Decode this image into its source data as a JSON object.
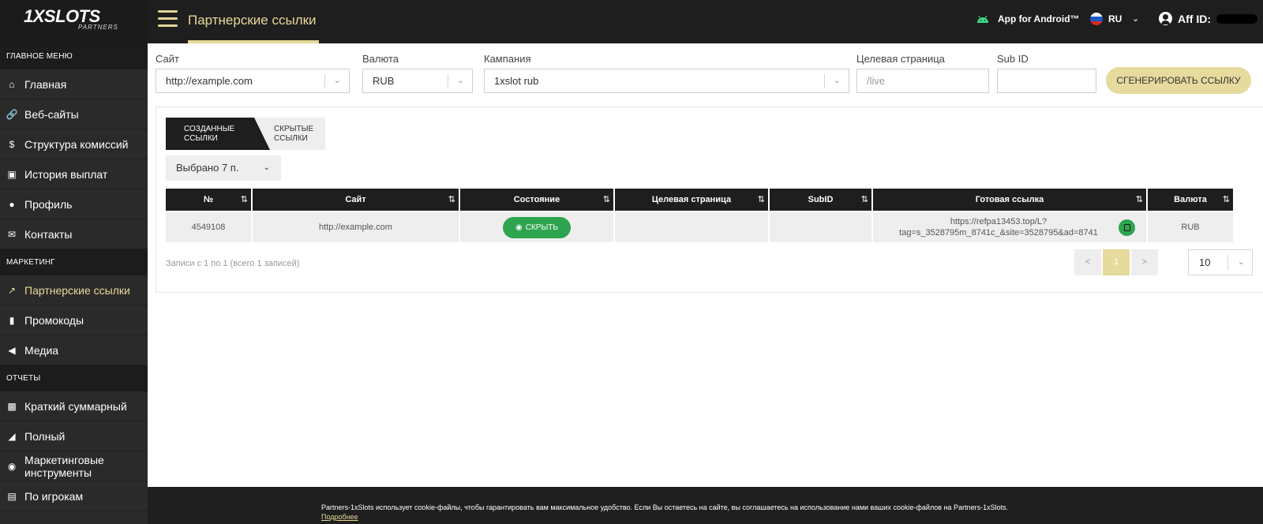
{
  "brand": {
    "logo_main": "1XSLOTS",
    "logo_sub": "PARTNERS"
  },
  "header": {
    "title": "Партнерские ссылки",
    "android_label": "App for Android™",
    "language": "RU",
    "aff_label": "Aff ID:"
  },
  "sidebar": {
    "sections": [
      {
        "title": "ГЛАВНОЕ МЕНЮ",
        "items": [
          {
            "label": "Главная",
            "icon": "home-icon"
          },
          {
            "label": "Веб-сайты",
            "icon": "link-icon"
          },
          {
            "label": "Структура комиссий",
            "icon": "dollar-icon"
          },
          {
            "label": "История выплат",
            "icon": "money-icon"
          },
          {
            "label": "Профиль",
            "icon": "user-icon"
          },
          {
            "label": "Контакты",
            "icon": "envelope-icon"
          }
        ]
      },
      {
        "title": "МАРКЕТИНГ",
        "items": [
          {
            "label": "Партнерские ссылки",
            "icon": "external-link-icon",
            "active": true
          },
          {
            "label": "Промокоды",
            "icon": "barcode-icon"
          },
          {
            "label": "Медиа",
            "icon": "bullhorn-icon"
          }
        ]
      },
      {
        "title": "ОТЧЕТЫ",
        "items": [
          {
            "label": "Краткий суммарный",
            "icon": "bar-chart-icon"
          },
          {
            "label": "Полный",
            "icon": "area-chart-icon"
          },
          {
            "label": "Маркетинговые инструменты",
            "icon": "palette-icon"
          },
          {
            "label": "По игрокам",
            "icon": "id-card-icon"
          }
        ]
      }
    ]
  },
  "filters": {
    "site_label": "Сайт",
    "site_value": "http://example.com",
    "currency_label": "Валюта",
    "currency_value": "RUB",
    "campaign_label": "Кампания",
    "campaign_value": "1xslot rub",
    "landing_label": "Целевая страница",
    "landing_placeholder": "/live",
    "subid_label": "Sub ID",
    "subid_value": "",
    "generate_button": "СГЕНЕРИРОВАТЬ ССЫЛКУ"
  },
  "tabs": {
    "created_line1": "СОЗДАННЫЕ",
    "created_line2": "ССЫЛКИ",
    "hidden_line1": "СКРЫТЫЕ",
    "hidden_line2": "ССЫЛКИ"
  },
  "columns_select": "Выбрано 7 п.",
  "table": {
    "headers": [
      "№",
      "Сайт",
      "Состояние",
      "Целевая страница",
      "SubID",
      "Готовая ссылка",
      "Валюта"
    ],
    "rows": [
      {
        "id": "4549108",
        "site": "http://example.com",
        "state_button": "СКРЫТЬ",
        "landing": "",
        "subid": "",
        "link_line1": "https://refpa13453.top/L?",
        "link_line2": "tag=s_3528795m_8741c_&site=3528795&ad=8741",
        "currency": "RUB"
      }
    ]
  },
  "pagination": {
    "records_text": "Записи с 1 по 1 (всего 1 записей)",
    "prev": "<",
    "current": "1",
    "next": ">",
    "per_page": "10"
  },
  "cookie": {
    "text": "Partners-1xSlots использует cookie-файлы, чтобы гарантировать вам максимальное удобство. Если Вы остаетесь на сайте, вы соглашаетесь на использование нами ваших cookie-файлов на Partners-1xSlots.",
    "link": "Подробнее"
  },
  "colors": {
    "accent": "#e8d99a",
    "button_gold": "#e6da9d",
    "success": "#2ea44f",
    "header_bg": "#1e1e1e",
    "sidebar_bg": "#2a2a2a"
  }
}
